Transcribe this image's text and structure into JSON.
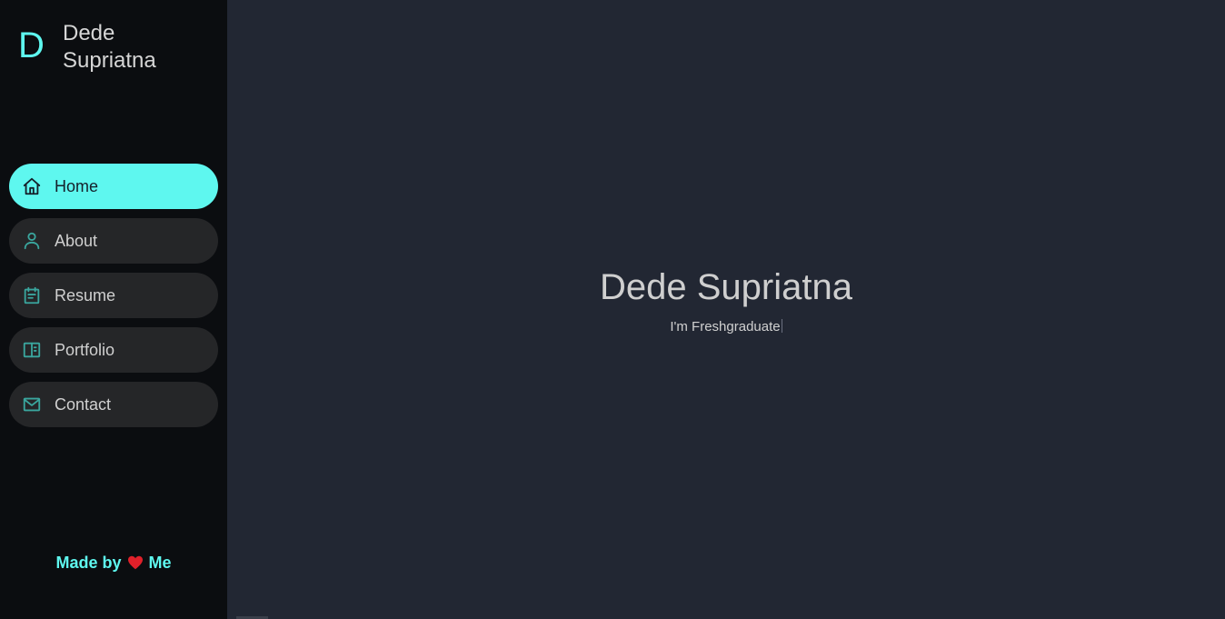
{
  "brand": {
    "letter": "D",
    "name": "Dede Supriatna"
  },
  "nav": {
    "items": [
      {
        "label": "Home",
        "icon": "home-icon",
        "active": true
      },
      {
        "label": "About",
        "icon": "user-icon",
        "active": false
      },
      {
        "label": "Resume",
        "icon": "calendar-icon",
        "active": false
      },
      {
        "label": "Portfolio",
        "icon": "portfolio-icon",
        "active": false
      },
      {
        "label": "Contact",
        "icon": "mail-icon",
        "active": false
      }
    ]
  },
  "footer": {
    "prefix": "Made by",
    "suffix": "Me",
    "icon": "heart-icon"
  },
  "hero": {
    "title": "Dede Supriatna",
    "subtitle": "I'm Freshgraduate"
  },
  "colors": {
    "accent": "#5ef7ef",
    "sidebar_bg": "#0b0d10",
    "main_bg": "#222733",
    "nav_bg": "#252628"
  }
}
